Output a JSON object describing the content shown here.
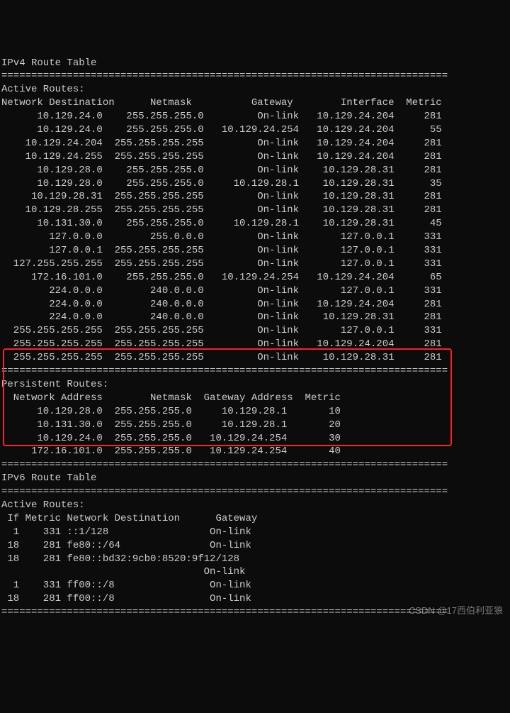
{
  "ipv4": {
    "title": "IPv4 Route Table",
    "sep": "===========================================================================",
    "activeRoutesLabel": "Active Routes:",
    "headers": {
      "dest": "Network Destination",
      "netmask": "Netmask",
      "gateway": "Gateway",
      "iface": "Interface",
      "metric": "Metric"
    },
    "routes": [
      {
        "dest": "10.129.24.0",
        "netmask": "255.255.255.0",
        "gateway": "On-link",
        "iface": "10.129.24.204",
        "metric": "281"
      },
      {
        "dest": "10.129.24.0",
        "netmask": "255.255.255.0",
        "gateway": "10.129.24.254",
        "iface": "10.129.24.204",
        "metric": "55"
      },
      {
        "dest": "10.129.24.204",
        "netmask": "255.255.255.255",
        "gateway": "On-link",
        "iface": "10.129.24.204",
        "metric": "281"
      },
      {
        "dest": "10.129.24.255",
        "netmask": "255.255.255.255",
        "gateway": "On-link",
        "iface": "10.129.24.204",
        "metric": "281"
      },
      {
        "dest": "10.129.28.0",
        "netmask": "255.255.255.0",
        "gateway": "On-link",
        "iface": "10.129.28.31",
        "metric": "281"
      },
      {
        "dest": "10.129.28.0",
        "netmask": "255.255.255.0",
        "gateway": "10.129.28.1",
        "iface": "10.129.28.31",
        "metric": "35"
      },
      {
        "dest": "10.129.28.31",
        "netmask": "255.255.255.255",
        "gateway": "On-link",
        "iface": "10.129.28.31",
        "metric": "281"
      },
      {
        "dest": "10.129.28.255",
        "netmask": "255.255.255.255",
        "gateway": "On-link",
        "iface": "10.129.28.31",
        "metric": "281"
      },
      {
        "dest": "10.131.30.0",
        "netmask": "255.255.255.0",
        "gateway": "10.129.28.1",
        "iface": "10.129.28.31",
        "metric": "45"
      },
      {
        "dest": "127.0.0.0",
        "netmask": "255.0.0.0",
        "gateway": "On-link",
        "iface": "127.0.0.1",
        "metric": "331"
      },
      {
        "dest": "127.0.0.1",
        "netmask": "255.255.255.255",
        "gateway": "On-link",
        "iface": "127.0.0.1",
        "metric": "331"
      },
      {
        "dest": "127.255.255.255",
        "netmask": "255.255.255.255",
        "gateway": "On-link",
        "iface": "127.0.0.1",
        "metric": "331"
      },
      {
        "dest": "172.16.101.0",
        "netmask": "255.255.255.0",
        "gateway": "10.129.24.254",
        "iface": "10.129.24.204",
        "metric": "65"
      },
      {
        "dest": "224.0.0.0",
        "netmask": "240.0.0.0",
        "gateway": "On-link",
        "iface": "127.0.0.1",
        "metric": "331"
      },
      {
        "dest": "224.0.0.0",
        "netmask": "240.0.0.0",
        "gateway": "On-link",
        "iface": "10.129.24.204",
        "metric": "281"
      },
      {
        "dest": "224.0.0.0",
        "netmask": "240.0.0.0",
        "gateway": "On-link",
        "iface": "10.129.28.31",
        "metric": "281"
      },
      {
        "dest": "255.255.255.255",
        "netmask": "255.255.255.255",
        "gateway": "On-link",
        "iface": "127.0.0.1",
        "metric": "331"
      },
      {
        "dest": "255.255.255.255",
        "netmask": "255.255.255.255",
        "gateway": "On-link",
        "iface": "10.129.24.204",
        "metric": "281"
      },
      {
        "dest": "255.255.255.255",
        "netmask": "255.255.255.255",
        "gateway": "On-link",
        "iface": "10.129.28.31",
        "metric": "281"
      }
    ],
    "persistentLabel": "Persistent Routes:",
    "pHeaders": {
      "addr": "Network Address",
      "netmask": "Netmask",
      "gateway": "Gateway Address",
      "metric": "Metric"
    },
    "persistent": [
      {
        "addr": "10.129.28.0",
        "netmask": "255.255.255.0",
        "gateway": "10.129.28.1",
        "metric": "10"
      },
      {
        "addr": "10.131.30.0",
        "netmask": "255.255.255.0",
        "gateway": "10.129.28.1",
        "metric": "20"
      },
      {
        "addr": "10.129.24.0",
        "netmask": "255.255.255.0",
        "gateway": "10.129.24.254",
        "metric": "30"
      },
      {
        "addr": "172.16.101.0",
        "netmask": "255.255.255.0",
        "gateway": "10.129.24.254",
        "metric": "40"
      }
    ]
  },
  "ipv6": {
    "title": "IPv6 Route Table",
    "sep": "===========================================================================",
    "activeRoutesLabel": "Active Routes:",
    "headers": {
      "if": "If",
      "metric": "Metric",
      "dest": "Network Destination",
      "gateway": "Gateway"
    },
    "routes": [
      {
        "if": "1",
        "metric": "331",
        "dest": "::1/128",
        "gateway": "On-link"
      },
      {
        "if": "18",
        "metric": "281",
        "dest": "fe80::/64",
        "gateway": "On-link"
      },
      {
        "if": "18",
        "metric": "281",
        "dest": "fe80::bd32:9cb0:8520:9f12/128",
        "gateway": "On-link"
      },
      {
        "if": "1",
        "metric": "331",
        "dest": "ff00::/8",
        "gateway": "On-link"
      },
      {
        "if": "18",
        "metric": "281",
        "dest": "ff00::/8",
        "gateway": "On-link"
      }
    ]
  },
  "watermark": "CSDN @17西伯利亚狼"
}
